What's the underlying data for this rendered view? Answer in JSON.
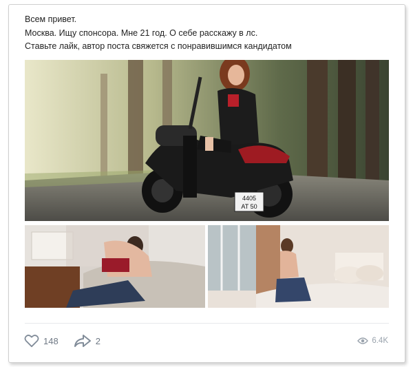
{
  "post": {
    "lines": [
      "Всем привет.",
      "Москва. Ищу спонсора. Мне 21 год. О себе расскажу в лс.",
      "Ставьте лайк, автор поста свяжется с понравившимся кандидатом"
    ],
    "photos": [
      {
        "name": "photo-motorcycle",
        "plate": [
          "4405",
          "AT 50"
        ]
      },
      {
        "name": "photo-bed-left"
      },
      {
        "name": "photo-bed-right"
      }
    ]
  },
  "footer": {
    "likes": "148",
    "shares": "2",
    "views": "6.4K",
    "icons": {
      "like": "heart-icon",
      "share": "share-arrow-icon",
      "views": "eye-icon"
    }
  }
}
